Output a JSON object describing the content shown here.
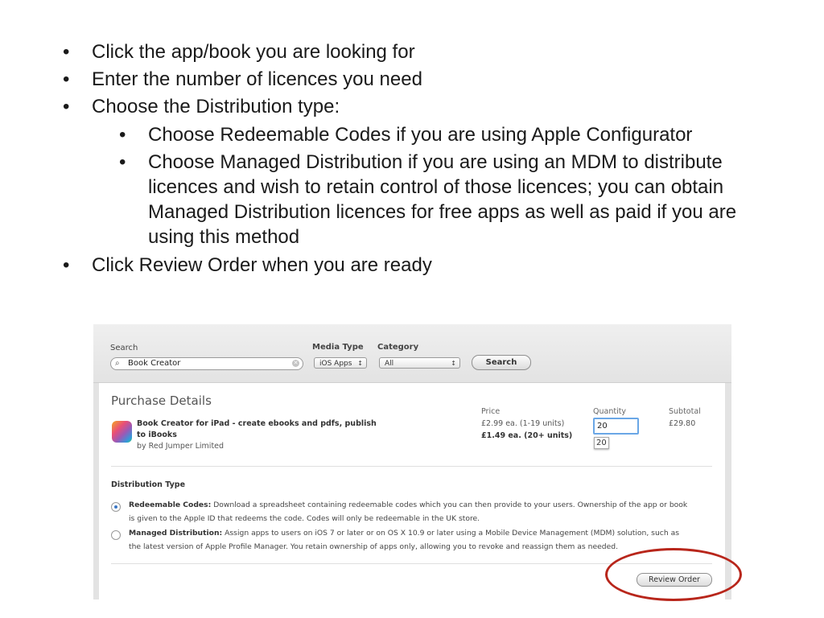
{
  "slide": {
    "bullets": [
      {
        "text": "Click the app/book you are looking for",
        "level": 1
      },
      {
        "text": "Enter the number of licences you need",
        "level": 1
      },
      {
        "text": "Choose the Distribution type:",
        "level": 1
      },
      {
        "text": "Choose Redeemable Codes if you are using Apple Configurator",
        "level": 2
      },
      {
        "text": "Choose Managed Distribution if you are using an MDM to distribute licences and wish to retain control of those licences; you can obtain Managed Distribution licences for free apps as well as paid if you are using this method",
        "level": 2
      },
      {
        "text": "Click Review Order when you are ready",
        "level": 1
      }
    ],
    "bullet_glyph": "•",
    "highlight_color": "#b8261b"
  },
  "search": {
    "label": "Search",
    "value": "Book Creator",
    "media_type_label": "Media Type",
    "media_type_value": "iOS Apps",
    "category_label": "Category",
    "category_value": "All",
    "button_label": "Search"
  },
  "purchase": {
    "title": "Purchase Details",
    "headers": {
      "price": "Price",
      "quantity": "Quantity",
      "subtotal": "Subtotal"
    },
    "app": {
      "name": "Book Creator for iPad - create ebooks and pdfs, publish to iBooks",
      "developer": "by Red Jumper Limited"
    },
    "price_tier1": "£2.99 ea. (1-19 units)",
    "price_tier2": "£1.49 ea. (20+ units)",
    "quantity": "20",
    "quantity_suggestion": "20",
    "subtotal": "£29.80"
  },
  "distribution": {
    "title": "Distribution Type",
    "options": [
      {
        "label": "Redeemable Codes:",
        "description": "Download a spreadsheet containing redeemable codes which you can then provide to your users. Ownership of the app or book is given to the Apple ID that redeems the code. Codes will only be redeemable in the UK store.",
        "selected": true
      },
      {
        "label": "Managed Distribution:",
        "description": "Assign apps to users on iOS 7 or later or on OS X 10.9 or later using a Mobile Device Management (MDM) solution, such as the latest version of Apple Profile Manager. You retain ownership of apps only, allowing you to revoke and reassign them as needed.",
        "selected": false
      }
    ],
    "review_button": "Review Order"
  }
}
